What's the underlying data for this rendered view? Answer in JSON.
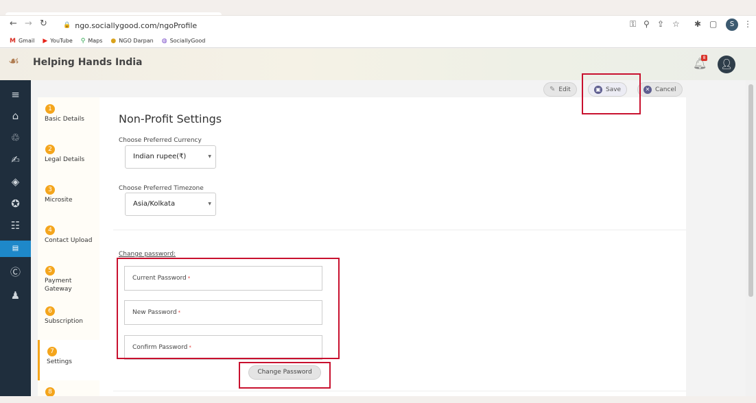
{
  "browser": {
    "url": "ngo.sociallygood.com/ngoProfile",
    "profile_initial": "S",
    "bookmarks": [
      {
        "label": "Gmail",
        "icon": "gmail-icon",
        "glyph": "M",
        "color": "#d93025"
      },
      {
        "label": "YouTube",
        "icon": "youtube-icon",
        "glyph": "▶",
        "color": "#e62117"
      },
      {
        "label": "Maps",
        "icon": "maps-icon",
        "glyph": "⚲",
        "color": "#34a853"
      },
      {
        "label": "NGO Darpan",
        "icon": "ngo-darpan-icon",
        "glyph": "●",
        "color": "#d9a21b"
      },
      {
        "label": "SociallyGood",
        "icon": "sociallygood-icon",
        "glyph": "◍",
        "color": "#7b4fc9"
      }
    ]
  },
  "header": {
    "title": "Helping Hands India",
    "notification_count": "8"
  },
  "actions": {
    "edit": "Edit",
    "save": "Save",
    "cancel": "Cancel"
  },
  "steps": [
    {
      "num": "1",
      "label": "Basic Details"
    },
    {
      "num": "2",
      "label": "Legal Details"
    },
    {
      "num": "3",
      "label": "Microsite"
    },
    {
      "num": "4",
      "label": "Contact Upload"
    },
    {
      "num": "5",
      "label": "Payment Gateway"
    },
    {
      "num": "6",
      "label": "Subscription"
    },
    {
      "num": "7",
      "label": "Settings"
    },
    {
      "num": "8",
      "label": ""
    }
  ],
  "settings": {
    "title": "Non-Profit Settings",
    "currency_label": "Choose Preferred Currency",
    "currency_value": "Indian rupee(₹)",
    "timezone_label": "Choose Preferred Timezone",
    "timezone_value": "Asia/Kolkata",
    "change_password_label": "Change password:",
    "current_password": "Current Password",
    "new_password": "New Password",
    "confirm_password": "Confirm Password",
    "required_mark": "*",
    "change_password_button": "Change Password"
  },
  "colors": {
    "accent": "#f4a51c",
    "sidebar": "#1f2e3d",
    "highlight": "#c8102e",
    "active_nav": "#1e88c9"
  }
}
